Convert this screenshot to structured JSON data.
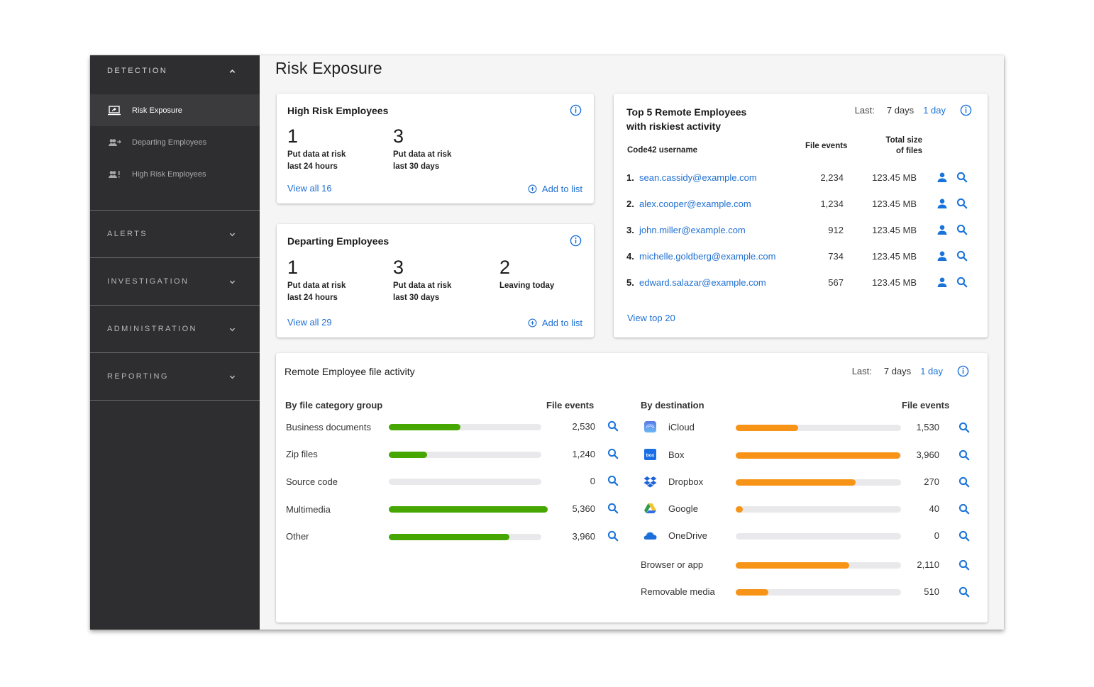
{
  "sidebar": {
    "sections": [
      {
        "label": "DETECTION",
        "expanded": true,
        "items": [
          {
            "label": "Risk Exposure",
            "icon": "laptop-share-icon",
            "active": true
          },
          {
            "label": "Departing Employees",
            "icon": "users-departing-icon",
            "active": false
          },
          {
            "label": "High Risk Employees",
            "icon": "users-alert-icon",
            "active": false
          }
        ]
      },
      {
        "label": "ALERTS",
        "expanded": false
      },
      {
        "label": "INVESTIGATION",
        "expanded": false
      },
      {
        "label": "ADMINISTRATION",
        "expanded": false
      },
      {
        "label": "REPORTING",
        "expanded": false
      }
    ]
  },
  "page": {
    "title": "Risk Exposure"
  },
  "high_risk": {
    "title": "High Risk Employees",
    "stats": [
      {
        "value": "1",
        "line1": "Put data at risk",
        "line2": "last 24 hours"
      },
      {
        "value": "3",
        "line1": "Put data at risk",
        "line2": "last 30 days"
      }
    ],
    "view_all": "View all 16",
    "add_to_list": "Add to list"
  },
  "departing": {
    "title": "Departing Employees",
    "stats": [
      {
        "value": "1",
        "line1": "Put data at risk",
        "line2": "last 24 hours"
      },
      {
        "value": "3",
        "line1": "Put data at risk",
        "line2": "last 30 days"
      },
      {
        "value": "2",
        "line1": "Leaving today",
        "line2": ""
      }
    ],
    "view_all": "View all 29",
    "add_to_list": "Add to list"
  },
  "top5": {
    "title_line1": "Top 5 Remote Employees",
    "title_line2": "with riskiest activity",
    "range_label": "Last:",
    "range_options": [
      "7 days",
      "1 day"
    ],
    "range_selected": "1 day",
    "columns": {
      "username": "Code42 username",
      "events": "File events",
      "size_line1": "Total size",
      "size_line2": "of files"
    },
    "rows": [
      {
        "rank": "1.",
        "user": "sean.cassidy@example.com",
        "events": "2,234",
        "size": "123.45 MB"
      },
      {
        "rank": "2.",
        "user": "alex.cooper@example.com",
        "events": "1,234",
        "size": "123.45 MB"
      },
      {
        "rank": "3.",
        "user": "john.miller@example.com",
        "events": "912",
        "size": "123.45 MB"
      },
      {
        "rank": "4.",
        "user": "michelle.goldberg@example.com",
        "events": "734",
        "size": "123.45 MB"
      },
      {
        "rank": "5.",
        "user": "edward.salazar@example.com",
        "events": "567",
        "size": "123.45 MB"
      }
    ],
    "view_top": "View top 20"
  },
  "activity": {
    "title": "Remote Employee file activity",
    "range_label": "Last:",
    "range_options": [
      "7 days",
      "1 day"
    ],
    "range_selected": "1 day",
    "category": {
      "heading": "By file category group",
      "events_heading": "File events",
      "color": "#46a701",
      "rows": [
        {
          "name": "Business documents",
          "value": "2,530",
          "fill": 0.47
        },
        {
          "name": "Zip files",
          "value": "1,240",
          "fill": 0.25
        },
        {
          "name": "Source code",
          "value": "0",
          "fill": 0
        },
        {
          "name": "Multimedia",
          "value": "5,360",
          "fill": 1.0
        },
        {
          "name": "Other",
          "value": "3,960",
          "fill": 0.79
        }
      ]
    },
    "destination": {
      "heading": "By destination",
      "events_heading": "File events",
      "color": "#f79418",
      "rows": [
        {
          "name": "iCloud",
          "icon": "icloud-icon",
          "value": "1,530",
          "fill": 0.38
        },
        {
          "name": "Box",
          "icon": "box-icon",
          "value": "3,960",
          "fill": 1.0
        },
        {
          "name": "Dropbox",
          "icon": "dropbox-icon",
          "value": "270",
          "fill": 0.73
        },
        {
          "name": "Google",
          "icon": "google-drive-icon",
          "value": "40",
          "fill": 0.04
        },
        {
          "name": "OneDrive",
          "icon": "onedrive-icon",
          "value": "0",
          "fill": 0
        },
        {
          "name": "Browser or app",
          "icon": "",
          "value": "2,110",
          "fill": 0.69
        },
        {
          "name": "Removable media",
          "icon": "",
          "value": "510",
          "fill": 0.2
        }
      ]
    }
  },
  "colors": {
    "accent": "#1a73d9",
    "sidebar": "#2e2d30",
    "green": "#46a701",
    "orange": "#f79418"
  }
}
